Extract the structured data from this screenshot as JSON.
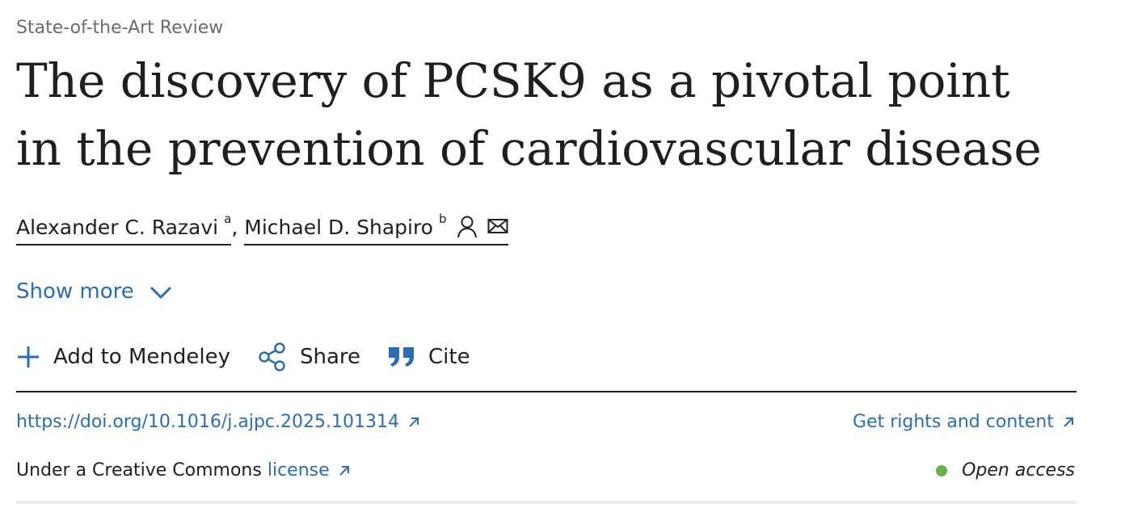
{
  "article": {
    "type": "State-of-the-Art Review",
    "title": "The discovery of PCSK9 as a pivotal point in the prevention of cardiovascular disease"
  },
  "authors": [
    {
      "name": "Alexander C. Razavi",
      "affiliation": "a"
    },
    {
      "name": "Michael D. Shapiro",
      "affiliation": "b"
    }
  ],
  "author_separator": ",",
  "show_more": {
    "label": "Show more"
  },
  "actions": {
    "mendeley": "Add to Mendeley",
    "share": "Share",
    "cite": "Cite"
  },
  "links": {
    "doi": "https://doi.org/10.1016/j.ajpc.2025.101314",
    "rights": "Get rights and content"
  },
  "license": {
    "prefix": "Under a Creative Commons",
    "link": "license"
  },
  "access": {
    "label": "Open access",
    "dot_color": "#6ab04c"
  },
  "colors": {
    "link": "#2a6db5",
    "text": "#1f1f1f",
    "muted": "#6b6b6b",
    "divider": "#1f1f1f"
  },
  "icons": {
    "author_profile": "person-icon",
    "author_email": "envelope-icon",
    "show_more": "chevron-down-icon",
    "mendeley": "plus-icon",
    "share": "share-icon",
    "cite": "quote-icon",
    "external": "external-link-icon"
  }
}
